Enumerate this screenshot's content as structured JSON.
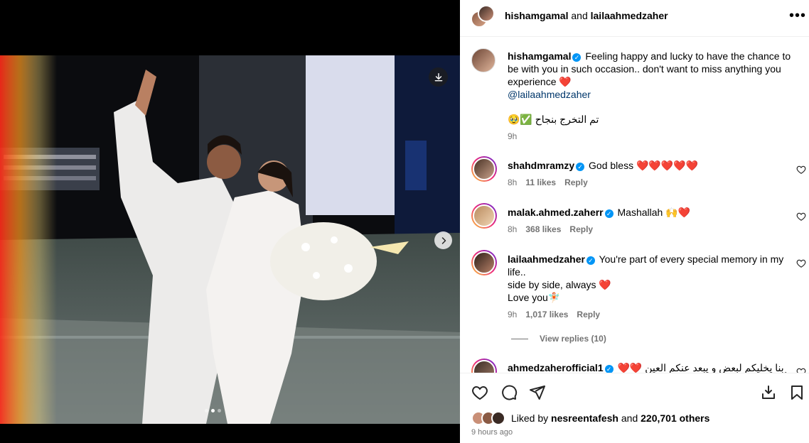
{
  "header": {
    "author1": "hishamgamal",
    "connector": " and ",
    "author2": "lailaahmedzaher",
    "more_label": "•••"
  },
  "caption": {
    "username": "hishamgamal",
    "text": "Feeling happy and lucky to have the chance to be with you in such occasion.. don't want to miss anything you experience ❤️",
    "mention": "@lailaahmedzaher",
    "arabic": "تم التخرج بنجاح ✅🥹",
    "time": "9h"
  },
  "comments": [
    {
      "username": "shahdmramzy",
      "text": "God bless ❤️❤️❤️❤️❤️",
      "time": "8h",
      "likes": "11 likes",
      "reply": "Reply"
    },
    {
      "username": "malak.ahmed.zaherr",
      "text": "Mashallah 🙌❤️",
      "time": "8h",
      "likes": "368 likes",
      "reply": "Reply"
    },
    {
      "username": "lailaahmedzaher",
      "text": "You're part of every special memory in my life..",
      "line2": "side by side, always ❤️",
      "line3": "Love you🧚🏻",
      "time": "9h",
      "likes": "1,017 likes",
      "reply": "Reply",
      "view_replies": "View replies (10)"
    },
    {
      "username": "ahmedzaherofficial1",
      "text": "❤️❤️ ربنا يخليكم لبعض و يبعد عنكم العين"
    }
  ],
  "likes": {
    "prefix": "Liked by ",
    "user": "nesreentafesh",
    "and": " and ",
    "count": "220,701 others"
  },
  "post_time": "9 hours ago",
  "carousel": {
    "total": 3,
    "active": 2
  },
  "colors": {
    "verified": "#0095f6",
    "link": "#00376b",
    "meta": "#737373"
  }
}
